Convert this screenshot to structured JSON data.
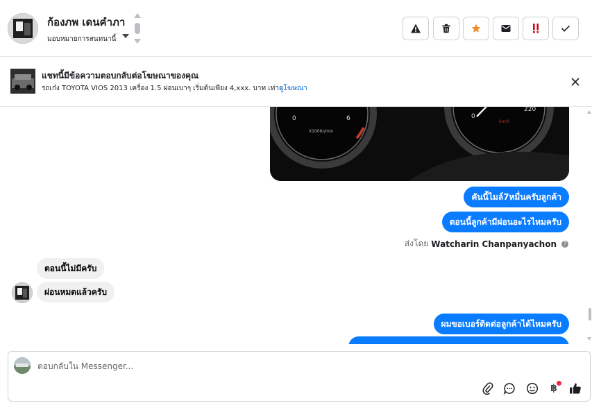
{
  "header": {
    "contact_name": "ก้องภพ เดนคำภา",
    "assign_label": "มอบหมายการสนทนานี้",
    "tools": [
      {
        "name": "report",
        "icon": "warning-triangle-icon"
      },
      {
        "name": "delete",
        "icon": "trash-icon"
      },
      {
        "name": "star",
        "icon": "star-icon",
        "color": "#f28c28"
      },
      {
        "name": "mark-unread",
        "icon": "envelope-icon"
      },
      {
        "name": "follow-up",
        "icon": "double-exclamation-icon",
        "color": "#d0021b"
      },
      {
        "name": "done",
        "icon": "checkmark-icon"
      }
    ]
  },
  "ad_banner": {
    "title": "แชทนี้มีข้อความตอบกลับต่อโฆษณาของคุณ",
    "description": "รถเก๋ง TOYOTA VIOS 2013 เครื่อง 1.5 ผ่อนเบาๆ เริ่มต้นเพียง 4,xxx. บาท เท่า...",
    "link_label": "ดูโฆษณา"
  },
  "speedometer": {
    "left_numbers": [
      "0",
      "6"
    ],
    "left_unit": "X1000r/min",
    "right_numbers": [
      "0",
      "220"
    ],
    "right_unit": "km/h"
  },
  "messages": {
    "outgoing_1": "คันนี้ไมล์7หมื่นครับลูกค้า",
    "outgoing_2": "ตอนนี้ลูกค้ามีผ่อนอะไรไหมครับ",
    "sent_by_prefix": "ส่งโดย",
    "sent_by_name": "Watcharin Chanpanyachon",
    "incoming_1": "ตอนนี้ไม่มีครับ",
    "incoming_2": "ผ่อนหมดแล้วครับ",
    "outgoing_3": "ผมขอเบอร์ติดต่อลูกค้าได้ไหมครับ"
  },
  "composer": {
    "placeholder": "ตอบกลับใน Messenger...",
    "currency_symbol": "฿"
  },
  "colors": {
    "messenger_blue": "#0a7cff",
    "link_blue": "#0064d1",
    "incoming_gray": "#f0f0f0",
    "like_gray": "#444950"
  }
}
